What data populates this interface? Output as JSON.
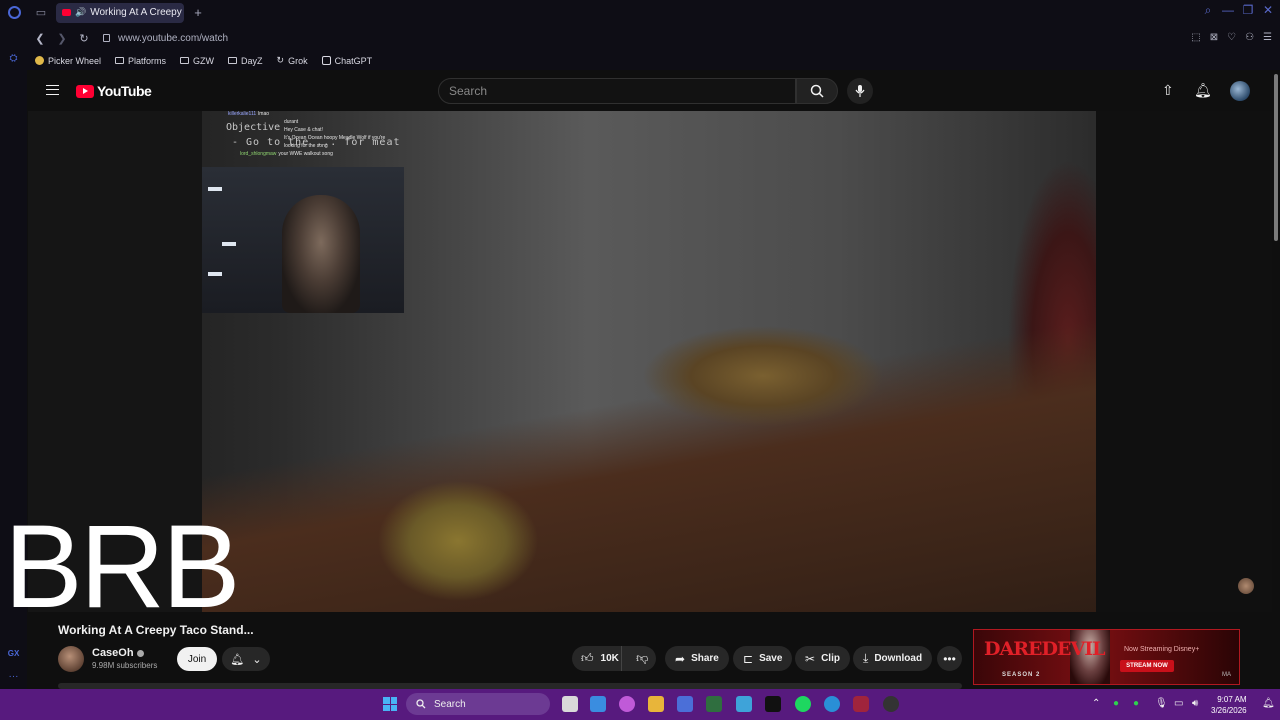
{
  "browser": {
    "tab_title": "Working At A Creepy T",
    "url": "www.youtube.com/watch",
    "bookmarks": [
      "Picker Wheel",
      "Platforms",
      "GZW",
      "DayZ",
      "Grok",
      "ChatGPT"
    ]
  },
  "youtube": {
    "logo_text": "YouTube",
    "search_placeholder": "Search"
  },
  "video": {
    "chat": [
      {
        "user": "killerkalie111",
        "msg": "lmao"
      },
      {
        "user": "",
        "msg": "durant"
      },
      {
        "user": "",
        "msg": "Hey Case & chat!"
      },
      {
        "user": "",
        "msg": "It's Ocean Ocean hoopy Meadle Wolf if you're"
      },
      {
        "user": "",
        "msg": "looking for the song"
      },
      {
        "user": "lord_shlongmaw",
        "msg": "your WWE walkout song"
      }
    ],
    "objective_label": "Objective",
    "objective_text": "- Go to the ... for meat",
    "overlay_text": "BRB"
  },
  "meta": {
    "title": "Working At A Creepy Taco Stand...",
    "channel": "CaseOh",
    "subscribers": "9.98M subscribers",
    "join_label": "Join",
    "like_count": "10K",
    "share_label": "Share",
    "save_label": "Save",
    "clip_label": "Clip",
    "download_label": "Download"
  },
  "ad": {
    "title": "DAREDEVIL",
    "season": "SEASON 2",
    "stream": "Now Streaming Disney+",
    "cta": "STREAM NOW",
    "rating": "MA"
  },
  "taskbar": {
    "search_label": "Search",
    "time": "9:07 AM",
    "date": "3/26/2026"
  }
}
